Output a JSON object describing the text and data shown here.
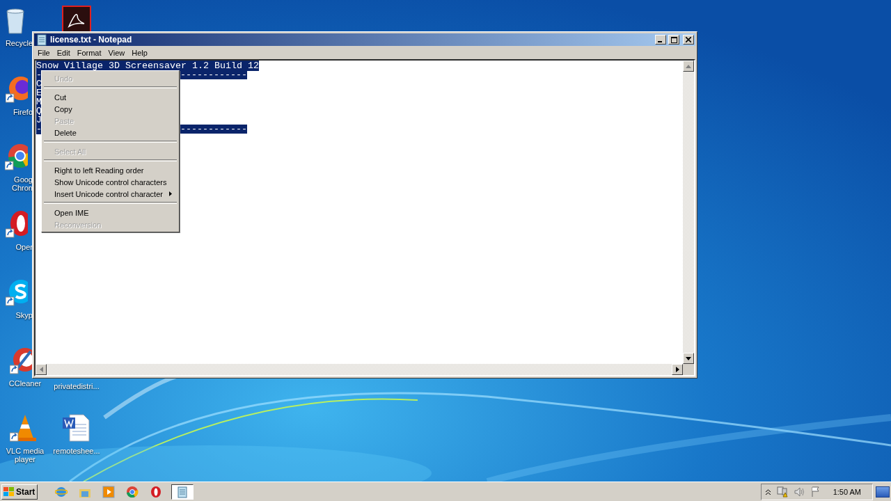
{
  "desktop": {
    "icons": [
      {
        "kind": "recycle-bin",
        "label": "Recycle"
      },
      {
        "kind": "acrobat"
      },
      {
        "kind": "firefox",
        "label": "Firefo"
      },
      {
        "kind": "chrome",
        "label": "Goog\nChron"
      },
      {
        "kind": "opera",
        "label": "Oper"
      },
      {
        "kind": "skype",
        "label": "Skyp"
      },
      {
        "kind": "ccleaner",
        "label": "CCleaner"
      },
      {
        "label": "privatedistri..."
      },
      {
        "kind": "vlc",
        "label": "VLC media\nplayer"
      },
      {
        "kind": "word",
        "label": "remoteshee..."
      }
    ]
  },
  "window": {
    "title": "license.txt - Notepad",
    "menu": [
      "File",
      "Edit",
      "Format",
      "View",
      "Help"
    ],
    "lines": [
      {
        "text": "Snow Village 3D Screensaver 1.2 Build 12"
      },
      {
        "text": "-",
        "text_right": "------------"
      },
      {
        "text": "C"
      },
      {
        "text": "E"
      },
      {
        "text": "M"
      },
      {
        "text": "Q"
      },
      {
        "text": "J"
      },
      {
        "text": "-",
        "text_right": "------------"
      }
    ]
  },
  "context_menu": [
    {
      "kind": "item",
      "label": "Undo",
      "disabled": true
    },
    {
      "kind": "separator"
    },
    {
      "kind": "item",
      "label": "Cut",
      "disabled": false
    },
    {
      "kind": "item",
      "label": "Copy",
      "disabled": false
    },
    {
      "kind": "item",
      "label": "Paste",
      "disabled": true
    },
    {
      "kind": "item",
      "label": "Delete",
      "disabled": false
    },
    {
      "kind": "separator"
    },
    {
      "kind": "item",
      "label": "Select All",
      "disabled": true
    },
    {
      "kind": "separator"
    },
    {
      "kind": "item",
      "label": "Right to left Reading order",
      "disabled": false
    },
    {
      "kind": "item",
      "label": "Show Unicode control characters",
      "disabled": false
    },
    {
      "kind": "submenu",
      "label": "Insert Unicode control character",
      "disabled": false
    },
    {
      "kind": "separator"
    },
    {
      "kind": "item",
      "label": "Open IME",
      "disabled": false
    },
    {
      "kind": "item",
      "label": "Reconversion",
      "disabled": true
    }
  ],
  "taskbar": {
    "start": "Start",
    "items": [
      {
        "kind": "ie",
        "selected": false
      },
      {
        "kind": "explorer",
        "selected": false
      },
      {
        "kind": "media-player",
        "selected": false
      },
      {
        "kind": "chrome",
        "selected": false
      },
      {
        "kind": "opera",
        "selected": false
      },
      {
        "kind": "notepad",
        "selected": true
      }
    ],
    "clock": "1:50 AM"
  }
}
